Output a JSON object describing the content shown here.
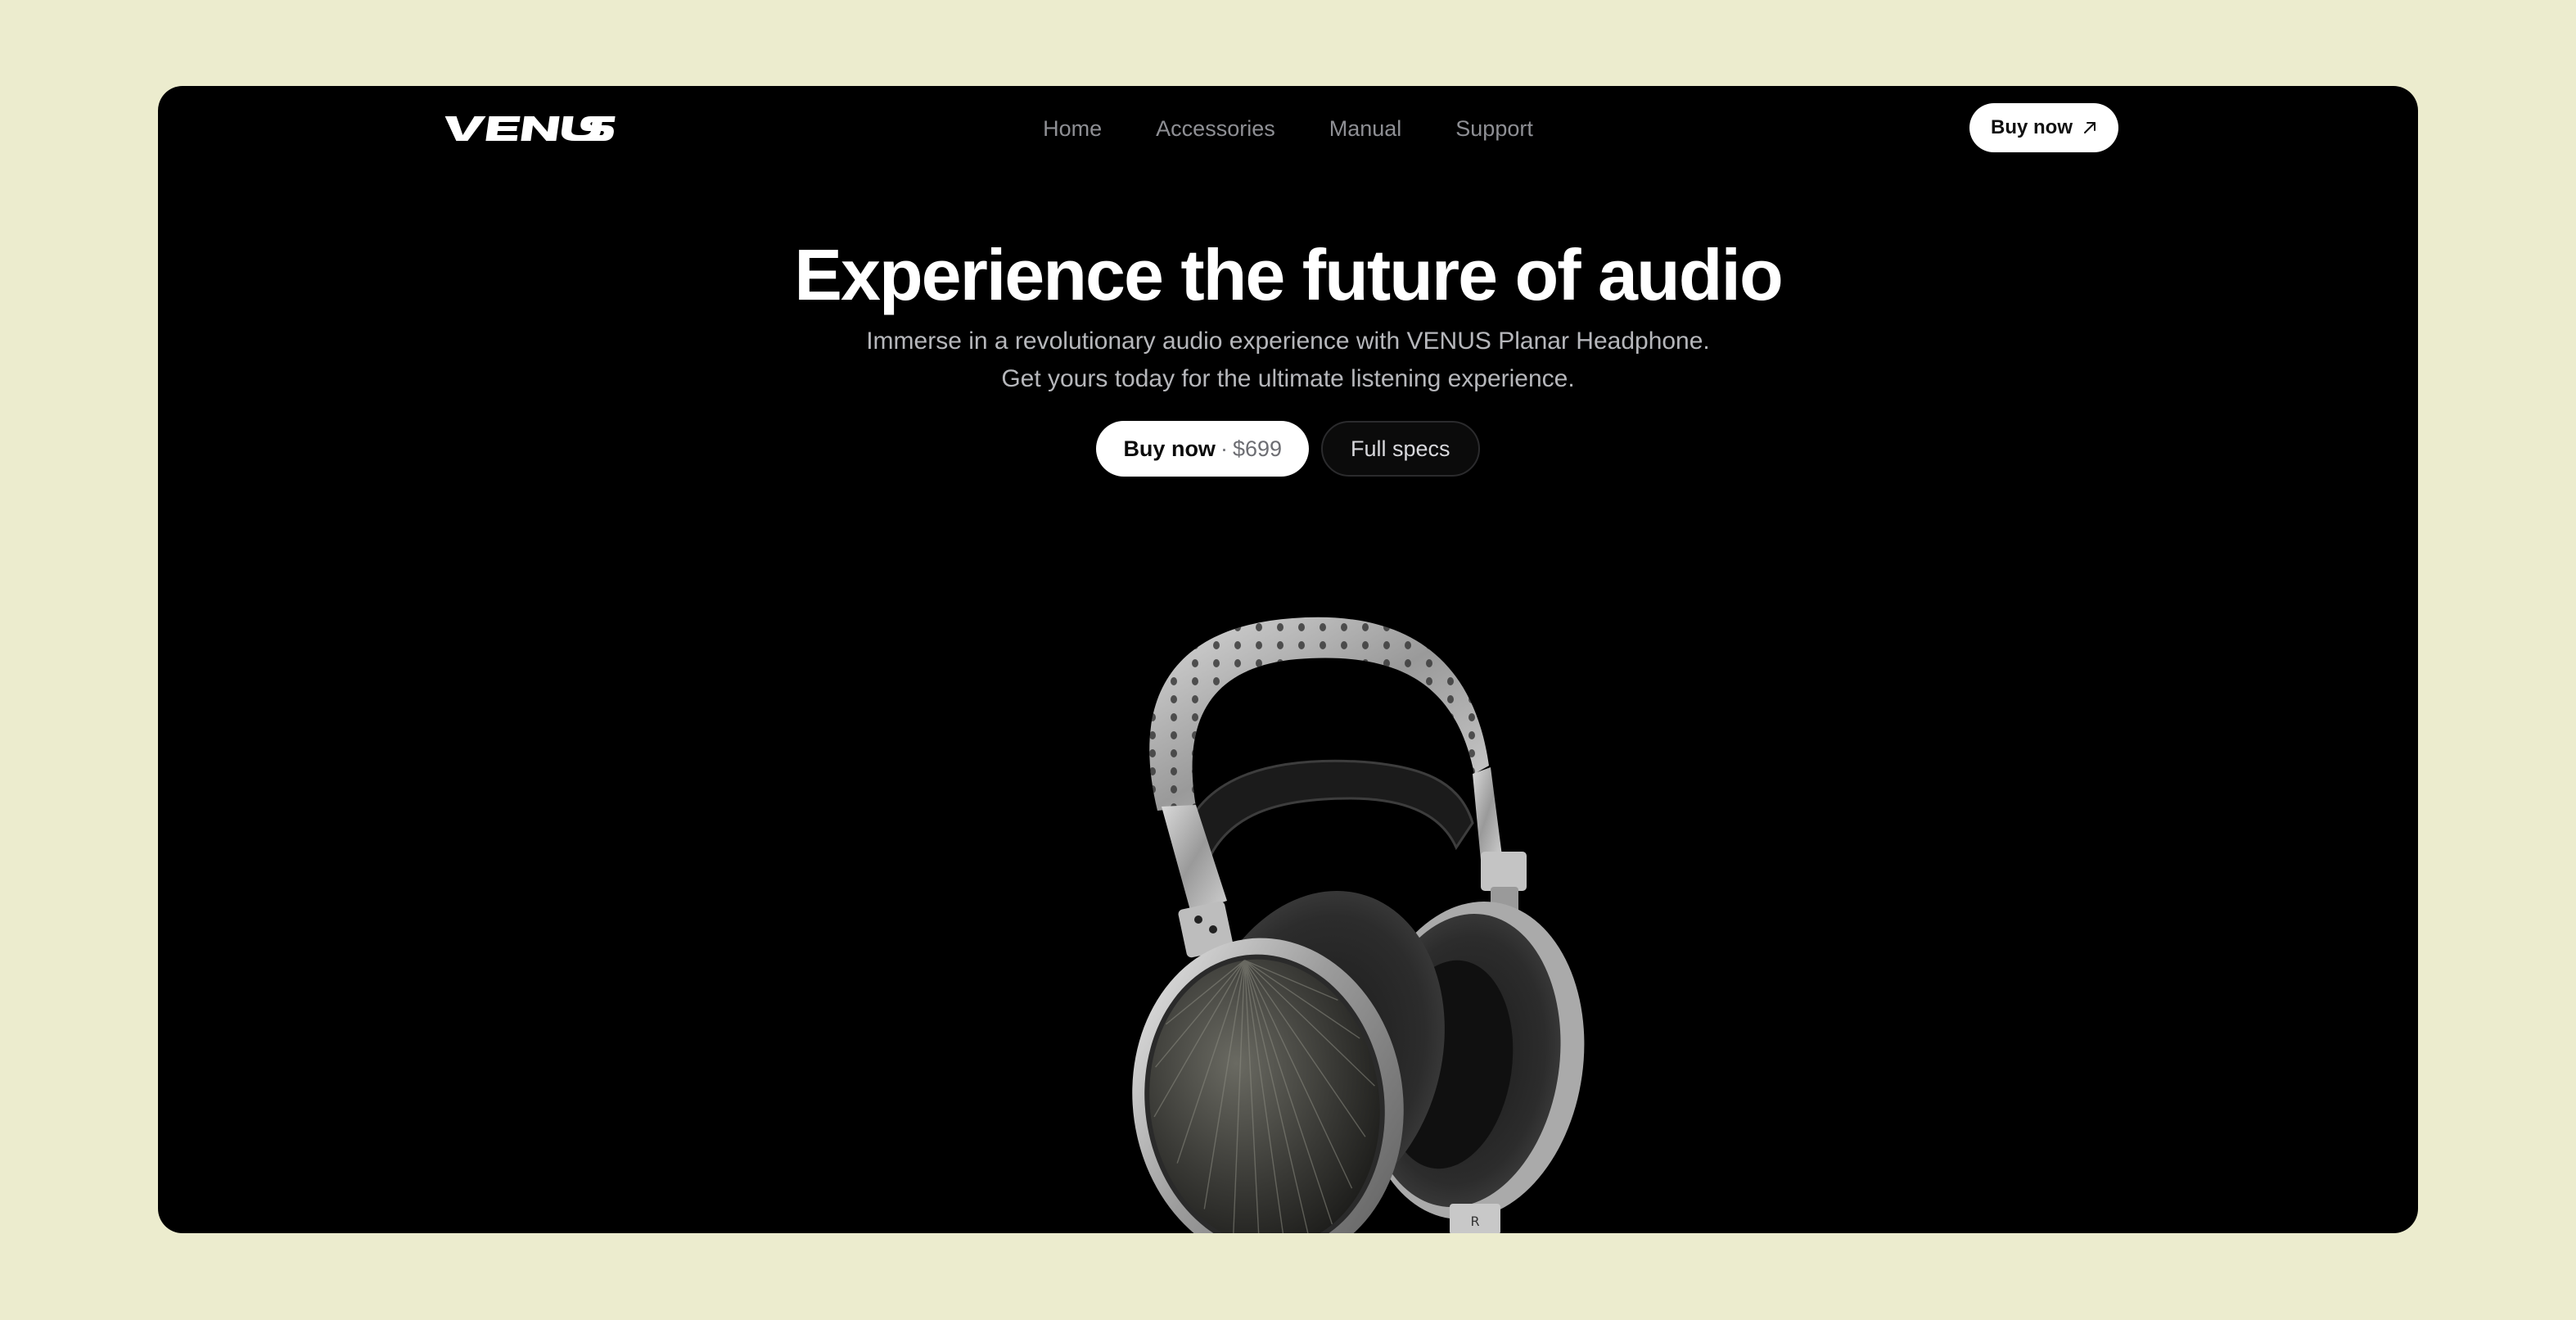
{
  "brand": {
    "logo_text": "VENUS",
    "colors": {
      "page_background": "#ececce",
      "frame_background": "#000000",
      "button_primary": "#ffffff"
    }
  },
  "nav": {
    "links": [
      {
        "label": "Home"
      },
      {
        "label": "Accessories"
      },
      {
        "label": "Manual"
      },
      {
        "label": "Support"
      }
    ],
    "buy_label": "Buy now",
    "buy_icon": "arrow-up-right-icon"
  },
  "hero": {
    "title": "Experience the future of audio",
    "subtitle_line1": "Immerse in a revolutionary audio experience with VENUS Planar Headphone.",
    "subtitle_line2": "Get yours today for the ultimate listening experience.",
    "primary_cta": {
      "label": "Buy now",
      "separator": "·",
      "price": "$699"
    },
    "secondary_cta": {
      "label": "Full specs"
    }
  },
  "product": {
    "image": "planar-headphone",
    "earcup_mark": "R"
  }
}
